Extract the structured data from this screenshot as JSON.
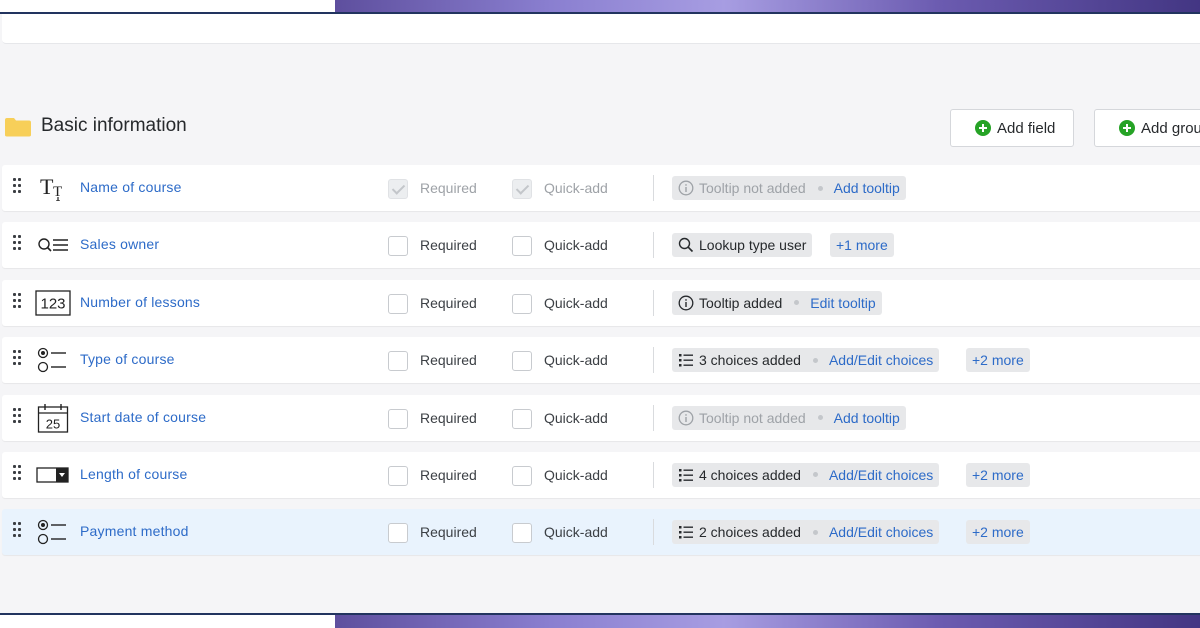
{
  "section": {
    "title": "Basic information",
    "add_field_label": "Add field",
    "add_group_label": "Add grou"
  },
  "labels": {
    "required": "Required",
    "quick_add": "Quick-add"
  },
  "colors": {
    "link": "#2d6bc8",
    "add_icon": "#26a326",
    "folder": "#f7cf59",
    "row_highlight": "#e9f3fd"
  },
  "fields": [
    {
      "name": "Name of course",
      "type_icon": "text-type-icon",
      "required_locked": true,
      "status": "Tooltip not added",
      "status_icon": "info-icon",
      "action": "Add tooltip",
      "more": ""
    },
    {
      "name": "Sales owner",
      "type_icon": "lookup-type-icon",
      "required_locked": false,
      "status": "Lookup type user",
      "status_icon": "search-icon",
      "action": "",
      "more": "+1 more"
    },
    {
      "name": "Number of lessons",
      "type_icon": "number-type-icon",
      "type_text": "123",
      "required_locked": false,
      "status": "Tooltip added",
      "status_icon": "info-icon",
      "action": "Edit tooltip",
      "more": ""
    },
    {
      "name": "Type of course",
      "type_icon": "radio-type-icon",
      "required_locked": false,
      "status": "3 choices added",
      "status_icon": "list-icon",
      "action": "Add/Edit choices",
      "more": "+2 more"
    },
    {
      "name": "Start date of course",
      "type_icon": "calendar-type-icon",
      "type_text": "25",
      "required_locked": false,
      "status": "Tooltip not added",
      "status_icon": "info-icon",
      "action": "Add tooltip",
      "more": ""
    },
    {
      "name": "Length of course",
      "type_icon": "dropdown-type-icon",
      "required_locked": false,
      "status": "4 choices added",
      "status_icon": "list-icon",
      "action": "Add/Edit choices",
      "more": "+2 more"
    },
    {
      "name": "Payment method",
      "type_icon": "radio-type-icon",
      "required_locked": false,
      "highlighted": true,
      "status": "2 choices added",
      "status_icon": "list-icon",
      "action": "Add/Edit choices",
      "more": "+2 more"
    }
  ]
}
